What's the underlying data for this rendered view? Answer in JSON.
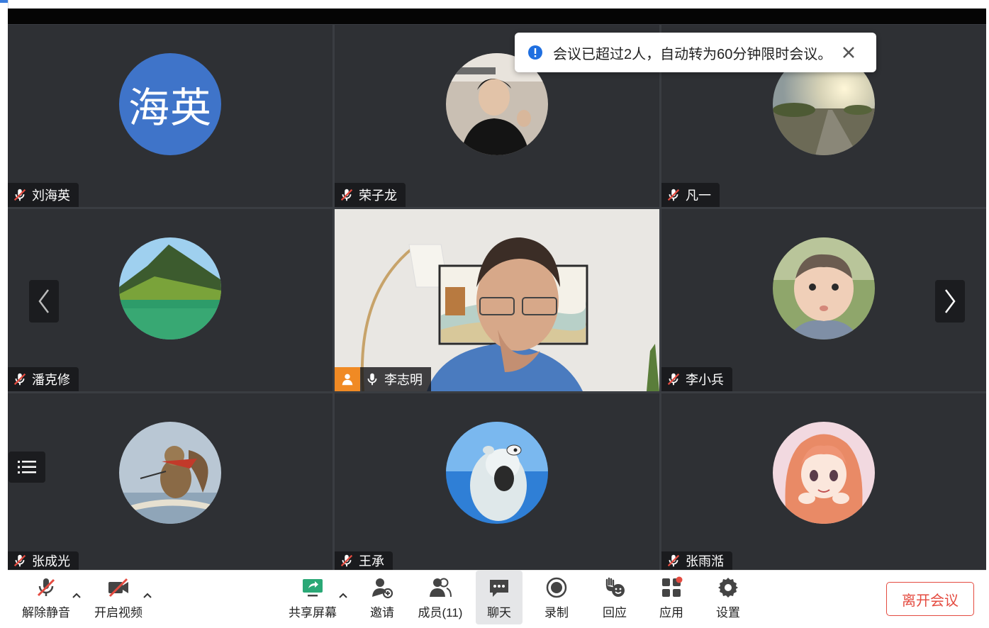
{
  "toast": {
    "message": "会议已超过2人，自动转为60分钟限时会议。"
  },
  "participants": [
    {
      "name": "刘海英",
      "avatar_text": "海英",
      "muted": true
    },
    {
      "name": "荣子龙",
      "muted": true
    },
    {
      "name": "凡一",
      "muted": true
    },
    {
      "name": "潘克修",
      "muted": true
    },
    {
      "name": "李志明",
      "muted": false,
      "host": true
    },
    {
      "name": "李小兵",
      "muted": true
    },
    {
      "name": "张成光",
      "muted": true
    },
    {
      "name": "王承",
      "muted": true
    },
    {
      "name": "张雨湉",
      "muted": true
    }
  ],
  "toolbar": {
    "unmute_label": "解除静音",
    "video_label": "开启视频",
    "share_label": "共享屏幕",
    "invite_label": "邀请",
    "members_label": "成员(11)",
    "chat_label": "聊天",
    "record_label": "录制",
    "react_label": "回应",
    "apps_label": "应用",
    "settings_label": "设置",
    "leave_label": "离开会议"
  },
  "colors": {
    "accent": "#3b7ddd",
    "leave": "#e44b40",
    "tile_bg": "#2e3034",
    "host_badge": "#f08a24"
  }
}
